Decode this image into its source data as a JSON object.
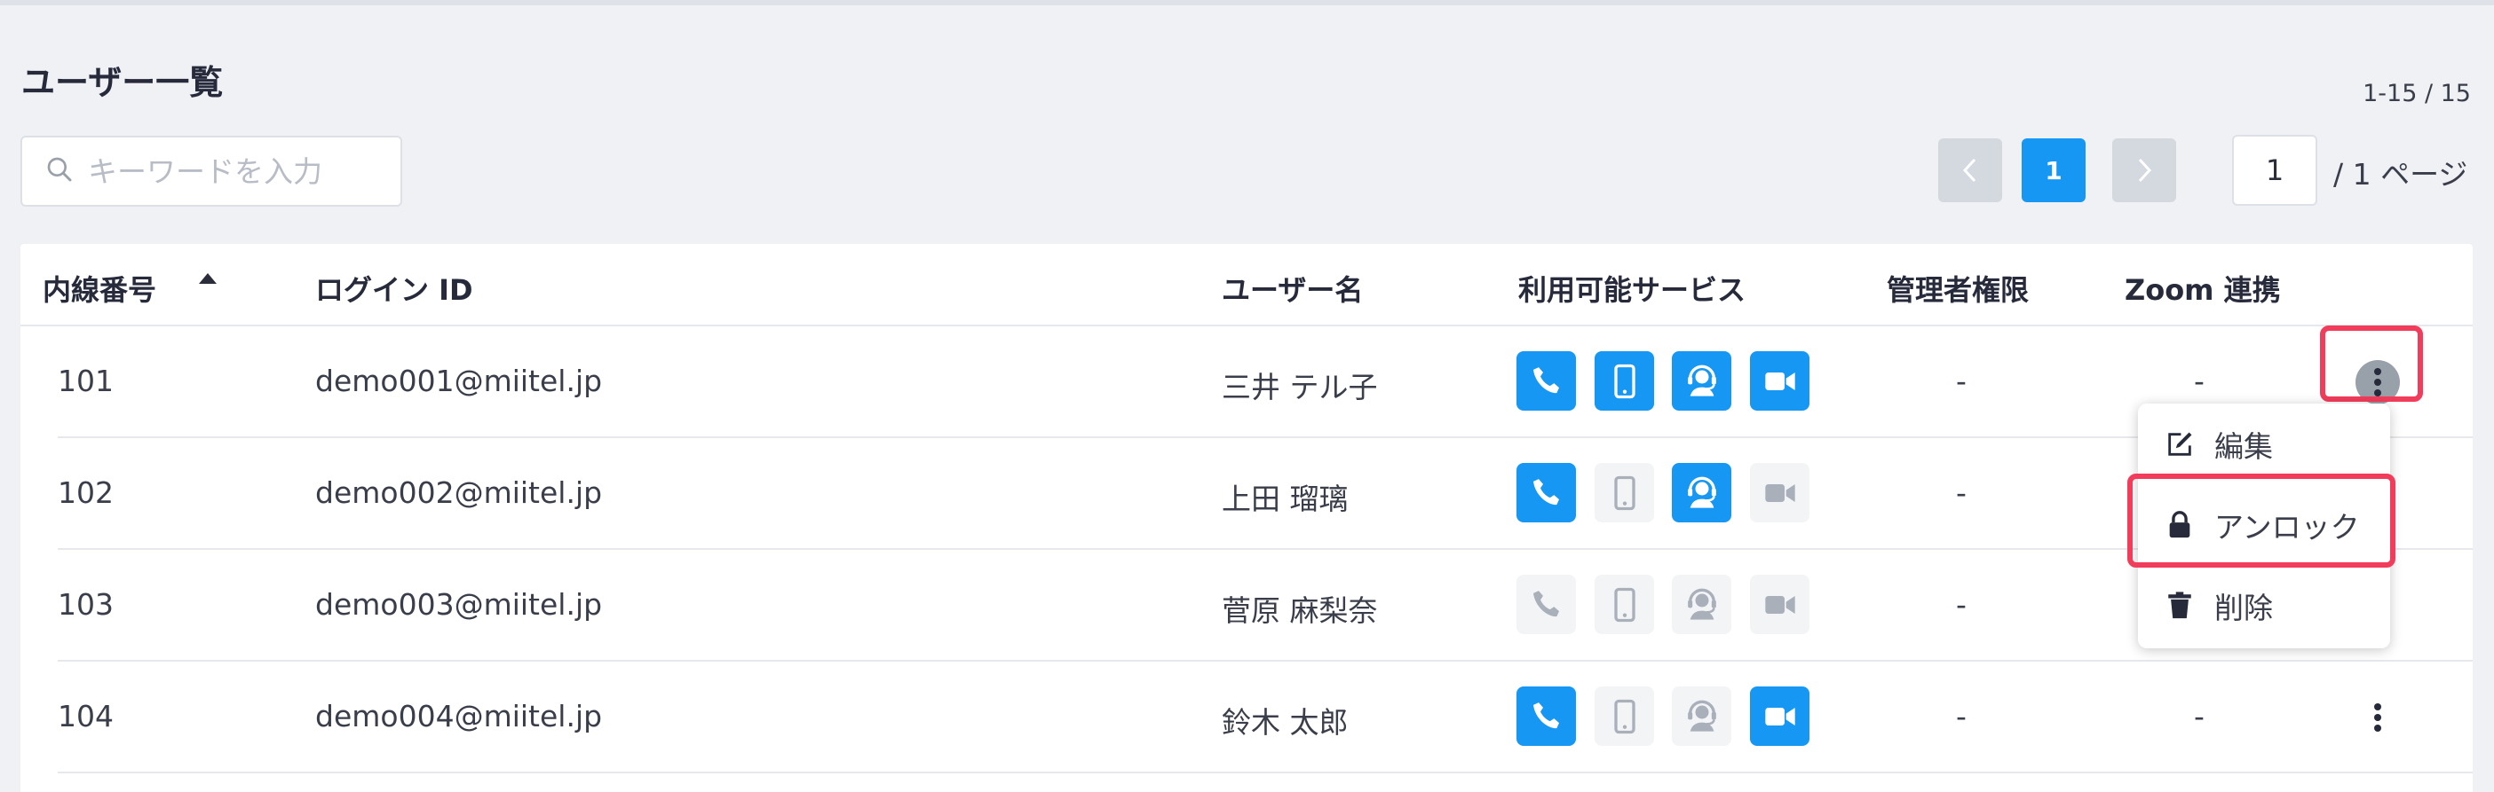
{
  "page": {
    "title": "ユーザー一覧",
    "count_text": "1-15 / 15"
  },
  "search": {
    "placeholder": "キーワードを入力"
  },
  "pagination": {
    "current_page": "1",
    "page_input_value": "1",
    "total_text": "/ 1 ページ"
  },
  "table": {
    "columns": [
      "内線番号",
      "ログイン ID",
      "ユーザー名",
      "利用可能サービス",
      "管理者権限",
      "Zoom 連携"
    ],
    "sort": {
      "column": "内線番号",
      "direction": "ascending"
    },
    "rows": [
      {
        "ext": "101",
        "login": "demo001@miitel.jp",
        "user": "三井 テル子",
        "services": {
          "phone": true,
          "mobile": true,
          "headset": true,
          "zoom": true
        },
        "admin": "-",
        "zoom": "-"
      },
      {
        "ext": "102",
        "login": "demo002@miitel.jp",
        "user": "上田 瑠璃",
        "services": {
          "phone": true,
          "mobile": false,
          "headset": true,
          "zoom": false
        },
        "admin": "-",
        "zoom": ""
      },
      {
        "ext": "103",
        "login": "demo003@miitel.jp",
        "user": "菅原 麻梨奈",
        "services": {
          "phone": false,
          "mobile": false,
          "headset": false,
          "zoom": false
        },
        "admin": "-",
        "zoom": ""
      },
      {
        "ext": "104",
        "login": "demo004@miitel.jp",
        "user": "鈴木 太郎",
        "services": {
          "phone": true,
          "mobile": false,
          "headset": false,
          "zoom": true
        },
        "admin": "-",
        "zoom": "-"
      }
    ]
  },
  "row_menu": {
    "items": [
      {
        "label": "編集",
        "icon": "edit-icon"
      },
      {
        "label": "アンロック",
        "icon": "lock-icon"
      },
      {
        "label": "削除",
        "icon": "trash-icon"
      }
    ]
  },
  "colors": {
    "accent": "#1597f3",
    "highlight": "#f23c5b",
    "service_off": "#f3f4f6",
    "service_off_icon": "#a9b0ba"
  }
}
